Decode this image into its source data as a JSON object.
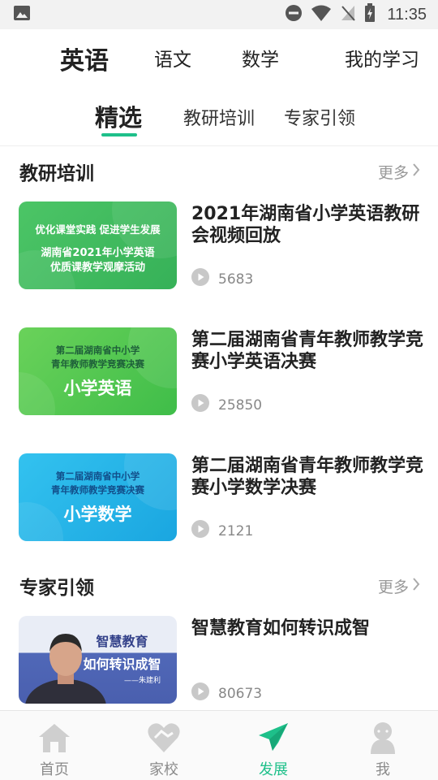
{
  "status_bar": {
    "time": "11:35"
  },
  "subject_tabs": [
    {
      "label": "英语",
      "active": true
    },
    {
      "label": "语文",
      "active": false
    },
    {
      "label": "数学",
      "active": false
    },
    {
      "label": "我的学习",
      "active": false
    }
  ],
  "sub_tabs": [
    {
      "label": "精选",
      "active": true
    },
    {
      "label": "教研培训",
      "active": false
    },
    {
      "label": "专家引领",
      "active": false
    }
  ],
  "sections": [
    {
      "title": "教研培训",
      "more_label": "更多",
      "items": [
        {
          "title": "2021年湖南省小学英语教研会视频回放",
          "views": "5683",
          "thumb_lines": [
            "优化课堂实践 促进学生发展",
            "湖南省2021年小学英语",
            "优质课教学观摩活动"
          ]
        },
        {
          "title": "第二届湖南省青年教师教学竞赛小学英语决赛",
          "views": "25850",
          "thumb_lines": [
            "第二届湖南省中小学",
            "青年教师教学竞赛决赛",
            "小学英语"
          ]
        },
        {
          "title": "第二届湖南省青年教师教学竞赛小学数学决赛",
          "views": "2121",
          "thumb_lines": [
            "第二届湖南省中小学",
            "青年教师教学竞赛决赛",
            "小学数学"
          ]
        }
      ]
    },
    {
      "title": "专家引领",
      "more_label": "更多",
      "items": [
        {
          "title": "智慧教育如何转识成智",
          "views": "80673",
          "thumb_lines": [
            "智慧教育",
            "如何转识成智",
            "——朱建利"
          ]
        }
      ]
    }
  ],
  "bottom_nav": [
    {
      "label": "首页",
      "icon": "home-icon",
      "active": false
    },
    {
      "label": "家校",
      "icon": "heart-handshake-icon",
      "active": false
    },
    {
      "label": "发展",
      "icon": "paper-plane-icon",
      "active": true
    },
    {
      "label": "我",
      "icon": "person-icon",
      "active": false
    }
  ],
  "colors": {
    "accent": "#1ec08a",
    "thumb1": "#3fba5c",
    "thumb2": "#4cc84e",
    "thumb3": "#1fb4e8",
    "thumb4": "#5068b8"
  }
}
